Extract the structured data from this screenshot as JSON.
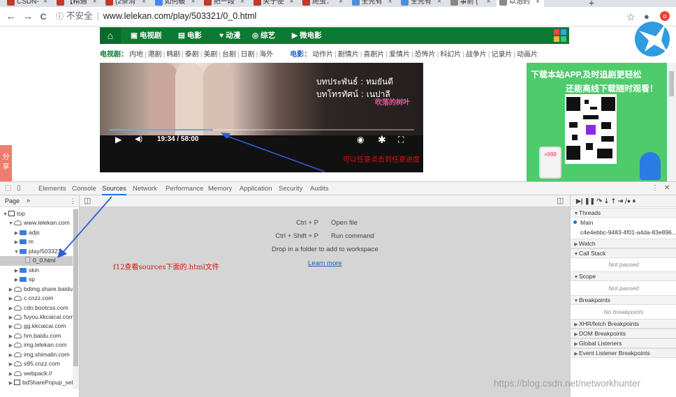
{
  "browser": {
    "tabs": [
      {
        "title": "CSDN-",
        "color": "#c0392b",
        "active": false
      },
      {
        "title": "【精通",
        "color": "#c0392b",
        "active": false
      },
      {
        "title": "(2条消",
        "color": "#c0392b",
        "active": false
      },
      {
        "title": "如何破",
        "color": "#4285f4",
        "active": false
      },
      {
        "title": "把一段",
        "color": "#c0392b",
        "active": false
      },
      {
        "title": "关于使",
        "color": "#c0392b",
        "active": false
      },
      {
        "title": "爬虫：",
        "color": "#c0392b",
        "active": false
      },
      {
        "title": "全先有",
        "color": "#4a90d9",
        "active": false
      },
      {
        "title": "全先有",
        "color": "#4a90d9",
        "active": false
      },
      {
        "title": "事前 (",
        "color": "#888888",
        "active": false
      },
      {
        "title": "以治的",
        "color": "#888888",
        "active": true
      }
    ],
    "new_tab": "+",
    "back_icon": "←",
    "forward_icon": "→",
    "reload_icon": "C",
    "security_icon": "ⓘ",
    "security_label": "不安全",
    "url": "www.lelekan.com/play/503321/0_0.html",
    "star_icon": "☆",
    "profile_icon": "●",
    "extension_label": "o"
  },
  "site": {
    "nav_home_icon": "⌂",
    "nav_items": [
      "电视剧",
      "电影",
      "动漫",
      "综艺",
      "微电影"
    ],
    "nav_icons": [
      "▣",
      "▤",
      "♥",
      "◎",
      "▶"
    ],
    "sub_cat_tv": "电视剧：",
    "sub_tv": [
      "内地",
      "港剧",
      "韩剧",
      "泰剧",
      "美剧",
      "台剧",
      "日剧",
      "海外"
    ],
    "sub_cat_movie": "电影：",
    "sub_movie": [
      "动作片",
      "剧情片",
      "喜剧片",
      "爱情片",
      "恐怖片",
      "科幻片",
      "战争片",
      "记录片",
      "动画片"
    ],
    "share_label": "分享",
    "player": {
      "credit_1": "บทประพันธ์ : ทมยันตี",
      "credit_2": "บทโทรทัศน์ : เนปาลี",
      "subtitle_cn": "吹落的树叶",
      "play_icon": "▶",
      "volume_icon": "◀)",
      "time": "19:34 / 58:00",
      "progress": 0.34,
      "camera_icon": "◉",
      "settings_icon": "✱",
      "fullscreen_icon": "⛶"
    },
    "annotation_seek": "可以任意点击到任意进度",
    "ad": {
      "line1": "下载本站APP,及时追剧更轻松",
      "line2": "还能离线下载随时观看！",
      "phone_badge": "+999"
    }
  },
  "devtools": {
    "tabs": [
      "Elements",
      "Console",
      "Sources",
      "Network",
      "Performance",
      "Memory",
      "Application",
      "Security",
      "Audits"
    ],
    "active_tab": "Sources",
    "inspect_icon": "⬚",
    "device_icon": "▯",
    "more_icon": "⋮",
    "close_icon": "✕",
    "navigator": {
      "tab": "Page",
      "chevrons": "»",
      "menu_icon": "⋮",
      "toggle_icon": "◫",
      "tree": [
        {
          "label": "top",
          "indent": 0,
          "arrow": "▼",
          "kind": "frame"
        },
        {
          "label": "www.lelekan.com",
          "indent": 1,
          "arrow": "▼",
          "kind": "cloud"
        },
        {
          "label": "adjs",
          "indent": 2,
          "arrow": "▶",
          "kind": "folder"
        },
        {
          "label": "m",
          "indent": 2,
          "arrow": "▶",
          "kind": "folder"
        },
        {
          "label": "play/503321",
          "indent": 2,
          "arrow": "▼",
          "kind": "folder"
        },
        {
          "label": "0_0.html",
          "indent": 3,
          "arrow": "",
          "kind": "file",
          "selected": true
        },
        {
          "label": "skin",
          "indent": 2,
          "arrow": "▶",
          "kind": "folder"
        },
        {
          "label": "sp",
          "indent": 2,
          "arrow": "▶",
          "kind": "folder"
        },
        {
          "label": "bdimg.share.baidu.",
          "indent": 1,
          "arrow": "▶",
          "kind": "cloud"
        },
        {
          "label": "c.cnzz.com",
          "indent": 1,
          "arrow": "▶",
          "kind": "cloud"
        },
        {
          "label": "cdn.bootcss.com",
          "indent": 1,
          "arrow": "▶",
          "kind": "cloud"
        },
        {
          "label": "fuyou.kkcaicai.com",
          "indent": 1,
          "arrow": "▶",
          "kind": "cloud"
        },
        {
          "label": "gg.kkcaicai.com",
          "indent": 1,
          "arrow": "▶",
          "kind": "cloud"
        },
        {
          "label": "hm.baidu.com",
          "indent": 1,
          "arrow": "▶",
          "kind": "cloud"
        },
        {
          "label": "img.lelekan.com",
          "indent": 1,
          "arrow": "▶",
          "kind": "cloud"
        },
        {
          "label": "img.shimalin.com",
          "indent": 1,
          "arrow": "▶",
          "kind": "cloud"
        },
        {
          "label": "s95.cnzz.com",
          "indent": 1,
          "arrow": "▶",
          "kind": "cloud"
        },
        {
          "label": "webpack://",
          "indent": 1,
          "arrow": "▶",
          "kind": "cloud"
        },
        {
          "label": "bdSharePopup_sele",
          "indent": 1,
          "arrow": "▶",
          "kind": "frame"
        }
      ]
    },
    "editor": {
      "shortcut_1_keys": "Ctrl + P",
      "shortcut_1_action": "Open file",
      "shortcut_2_keys": "Ctrl + Shift + P",
      "shortcut_2_action": "Run command",
      "drop_hint": "Drop in a folder to add to workspace",
      "learn_more": "Learn more",
      "annotation": "f12查看sources下面的.html文件"
    },
    "debugger": {
      "toolbar_icons": "▶|   ❚❚   ↷   ⇣   ⇡   ⇥   ⧸●   ⏸",
      "sections": [
        {
          "title": "Threads",
          "open": true
        },
        {
          "title": "Watch",
          "open": false
        },
        {
          "title": "Call Stack",
          "open": true
        },
        {
          "title": "Scope",
          "open": true
        },
        {
          "title": "Breakpoints",
          "open": true
        },
        {
          "title": "XHR/fetch Breakpoints",
          "open": false
        },
        {
          "title": "DOM Breakpoints",
          "open": false
        },
        {
          "title": "Global Listeners",
          "open": false
        },
        {
          "title": "Event Listener Breakpoints",
          "open": false
        }
      ],
      "thread_main": "Main",
      "thread_id": "c4e4ebbc-9483-4f01-a4da-83e896...",
      "callstack_empty": "Not paused",
      "scope_empty": "Not paused",
      "breakpoints_empty": "No breakpoints"
    }
  },
  "csdn_watermark": "https://blog.csdn.net/networkhunter"
}
